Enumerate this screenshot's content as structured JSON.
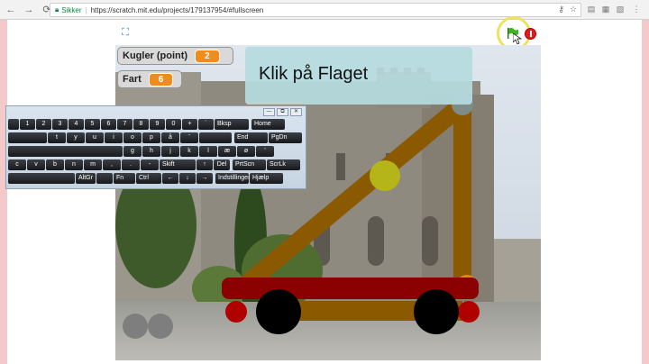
{
  "browser": {
    "back_icon": "arrow-left-icon",
    "forward_icon": "arrow-right-icon",
    "reload_icon": "reload-icon",
    "secure_label": "Sikker",
    "url": "https://scratch.mit.edu/projects/179137954/#fullscreen",
    "key_icon": "key-icon",
    "star_icon": "star-icon"
  },
  "stage": {
    "fullscreen_icon": "fullscreen-toggle-icon",
    "speech_text": "Klik på Flaget",
    "flag_icon": "green-flag-icon",
    "stop_icon": "stop-icon"
  },
  "variables": [
    {
      "label": "Kugler (point)",
      "value": "2"
    },
    {
      "label": "Fart",
      "value": "6"
    }
  ],
  "keyboard": {
    "controls": [
      "—",
      "⧉",
      "✕"
    ],
    "row1": [
      "",
      "1",
      "2",
      "3",
      "4",
      "5",
      "6",
      "7",
      "8",
      "9",
      "0",
      "+",
      "´",
      "Bksp",
      "Home",
      "PgUp"
    ],
    "row2": [
      "",
      "t",
      "y",
      "u",
      "i",
      "o",
      "p",
      "å",
      "¨",
      "",
      "End",
      "PgDn"
    ],
    "row3": [
      "",
      "g",
      "h",
      "j",
      "k",
      "l",
      "æ",
      "ø",
      "'",
      "",
      "Insert",
      "Pause"
    ],
    "row4": [
      "c",
      "v",
      "b",
      "n",
      "m",
      ",",
      ".",
      "-",
      "Skift",
      "↑",
      "Del",
      "PrtScn",
      "ScrLk"
    ],
    "row5": [
      "",
      "AltGr",
      "",
      "Fn",
      "Ctrl",
      "←",
      "↓",
      "→",
      "Indstillinger",
      "Hjælp"
    ]
  },
  "colors": {
    "frame": "#8b5a00",
    "cart": "#8b0000",
    "wheel": "#000000",
    "ball": "#b5b51a",
    "counterweight": "#e08a0a",
    "value_badge": "#f08c1e"
  }
}
